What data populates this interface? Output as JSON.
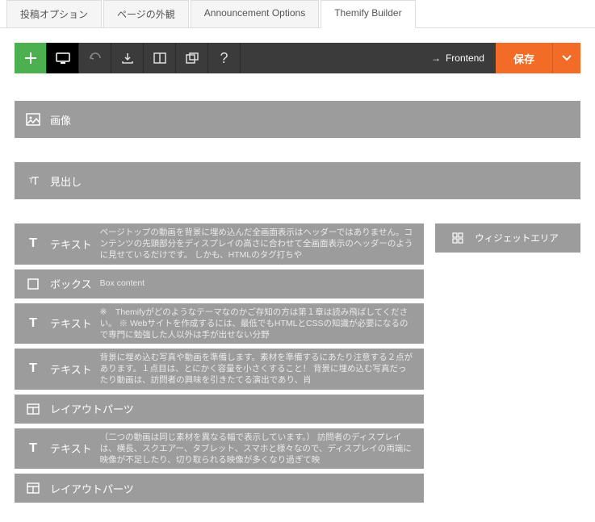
{
  "tabs": {
    "post_options": "投稿オプション",
    "page_appearance": "ページの外観",
    "announcement": "Announcement Options",
    "themify_builder": "Themify Builder"
  },
  "toolbar": {
    "frontend": "Frontend",
    "save": "保存"
  },
  "modules": {
    "image": {
      "label": "画像"
    },
    "heading": {
      "label": "見出し"
    },
    "text1": {
      "label": "テキスト",
      "preview": "ページトップの動画を背景に埋め込んだ全画面表示はヘッダーではありません。コンテンツの先頭部分をディスプレイの高さに合わせて全画面表示のヘッダーのように見せているだけです。 しかも、HTMLのタグ打ちや"
    },
    "box": {
      "label": "ボックス",
      "preview": "Box content"
    },
    "text2": {
      "label": "テキスト",
      "preview": "※　Themifyがどのようなテーマなのかご存知の方は第１章は読み飛ばしてください。 ※ Webサイトを作成するには、最低でもHTMLとCSSの知識が必要になるので専門に勉強した人以外は手が出せない分野"
    },
    "text3": {
      "label": "テキスト",
      "preview": "背景に埋め込む写真や動画を準備します。素材を準備するにあたり注意する２点があります。１点目は、とにかく容量を小さくすること！ 背景に埋め込む写真だったり動画は、訪問者の興味を引きたてる演出であり、肖"
    },
    "layout1": {
      "label": "レイアウトパーツ"
    },
    "text4": {
      "label": "テキスト",
      "preview": "（二つの動画は同じ素材を異なる幅で表示しています。） 訪問者のディスプレイは、横長、スクエアー、タブレット、スマホと様々なので、ディスプレイの両端に映像が不足したり、切り取られる映像が多くなり過ぎて映"
    },
    "layout2": {
      "label": "レイアウトパーツ"
    },
    "widget_area": {
      "label": "ウィジェットエリア"
    }
  }
}
